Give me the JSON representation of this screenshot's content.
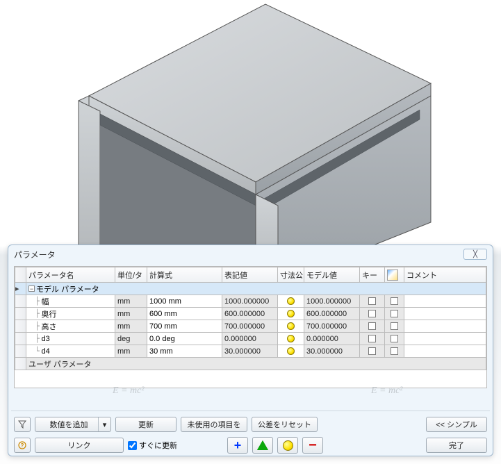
{
  "dialog": {
    "title": "パラメータ",
    "columns": {
      "name": "パラメータ名",
      "unit": "単位/タ",
      "equation": "計算式",
      "nominal": "表記値",
      "tol": "寸法公",
      "model_value": "モデル値",
      "key": "キー",
      "icon_header": "",
      "comment": "コメント"
    },
    "groups": {
      "model": "モデル パラメータ",
      "user": "ユーザ パラメータ"
    },
    "rows": [
      {
        "name": "幅",
        "unit": "mm",
        "equation": "1000 mm",
        "nominal": "1000.000000",
        "model_value": "1000.000000"
      },
      {
        "name": "奥行",
        "unit": "mm",
        "equation": "600 mm",
        "nominal": "600.000000",
        "model_value": "600.000000"
      },
      {
        "name": "高さ",
        "unit": "mm",
        "equation": "700 mm",
        "nominal": "700.000000",
        "model_value": "700.000000"
      },
      {
        "name": "d3",
        "unit": "deg",
        "equation": "0.0 deg",
        "nominal": "0.000000",
        "model_value": "0.000000"
      },
      {
        "name": "d4",
        "unit": "mm",
        "equation": "30 mm",
        "nominal": "30.000000",
        "model_value": "30.000000"
      }
    ],
    "buttons": {
      "add_numeric": "数値を追加",
      "update": "更新",
      "clear_unused": "未使用の項目を",
      "reset_tol": "公差をリセット",
      "link": "リンク",
      "auto_update": "すぐに更新",
      "simple": "<< シンプル",
      "done": "完了"
    },
    "watermark": "E = mc²"
  }
}
